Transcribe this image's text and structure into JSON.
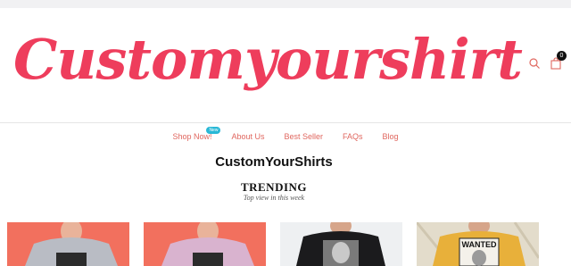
{
  "header": {
    "logo_text": "Customyourshirt",
    "cart_count": "0"
  },
  "nav": {
    "items": [
      {
        "label": "Shop Now!",
        "badge": "New"
      },
      {
        "label": "About Us"
      },
      {
        "label": "Best Seller"
      },
      {
        "label": "FAQs"
      },
      {
        "label": "Blog"
      }
    ]
  },
  "main": {
    "site_title": "CustomYourShirts",
    "section_title": "TRENDING",
    "section_subtitle": "Top view in this week"
  },
  "products": [
    {
      "background": "#f2705e",
      "shirt_color": "#b9bcc4"
    },
    {
      "background": "#f2705e",
      "shirt_color": "#d9b3cf"
    },
    {
      "background": "#eef0f2",
      "shirt_color": "#1b1b1d"
    },
    {
      "background": "#e3dccb",
      "shirt_color": "#e8b03a",
      "print_text": "WANTED"
    }
  ],
  "colors": {
    "brand": "#ee3d5c",
    "nav_link": "#e0675f",
    "badge": "#29b8d6"
  }
}
